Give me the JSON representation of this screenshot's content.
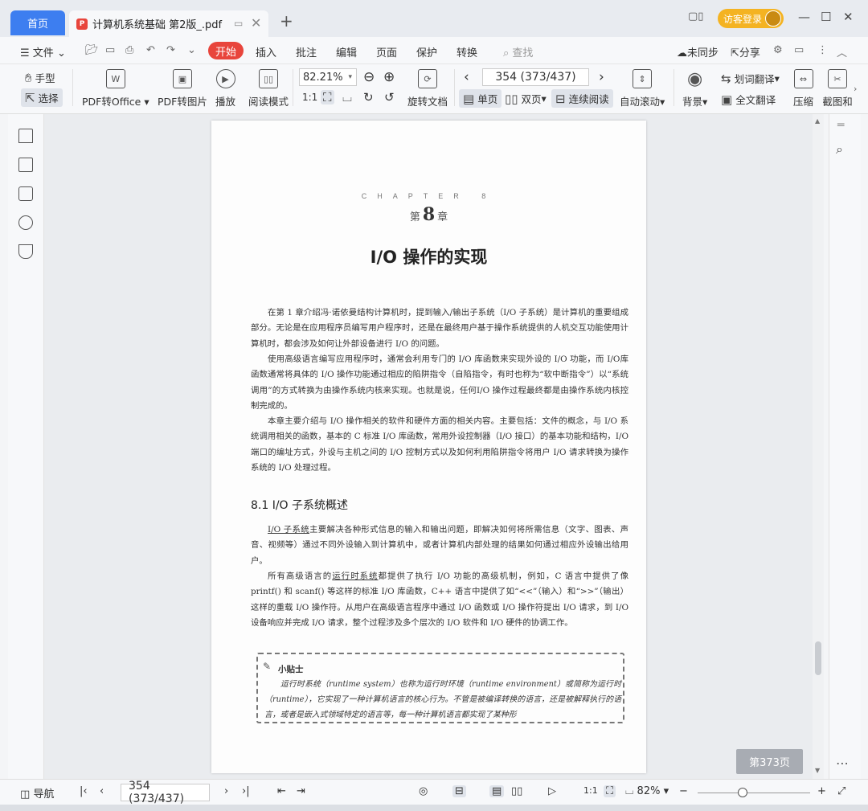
{
  "tabs": {
    "home": "首页",
    "doc_title": "计算机系统基础 第2版_.pdf"
  },
  "titlebar": {
    "guest_login": "访客登录"
  },
  "menu": {
    "file": "文件",
    "start": "开始",
    "items": [
      "插入",
      "批注",
      "编辑",
      "页面",
      "保护",
      "转换"
    ],
    "search_placeholder": "查找",
    "unsynced": "未同步",
    "share": "分享"
  },
  "ribbon": {
    "hand_tool": "手型",
    "select_tool": "选择",
    "pdf_to_office": "PDF转Office",
    "pdf_to_image": "PDF转图片",
    "play": "播放",
    "read_mode": "阅读模式",
    "zoom": "82.21%",
    "rotate_doc": "旋转文档",
    "page_input": "354 (373/437)",
    "single_page": "单页",
    "double_page": "双页",
    "continuous_read": "连续阅读",
    "auto_scroll": "自动滚动",
    "background": "背景",
    "word_translate": "划词翻译",
    "full_translate": "全文翻译",
    "compress": "压缩",
    "screenshot": "截图和"
  },
  "document": {
    "chapter_en": "CHAPTER 8",
    "chapter_prefix": "第",
    "chapter_number": "8",
    "chapter_suffix": "章",
    "chapter_title": "I/O 操作的实现",
    "intro_paragraphs": [
      "在第 1 章介绍冯·诺依曼结构计算机时，提到输入/输出子系统（I/O 子系统）是计算机的重要组成部分。无论是在应用程序员编写用户程序时，还是在最终用户基于操作系统提供的人机交互功能使用计算机时，都会涉及如何让外部设备进行 I/O 的问题。",
      "使用高级语言编写应用程序时，通常会利用专门的 I/O 库函数来实现外设的 I/O 功能，而 I/O库函数通常将具体的 I/O 操作功能通过相应的陷阱指令（自陷指令，有时也称为“软中断指令”）以“系统调用”的方式转换为由操作系统内核来实现。也就是说，任何I/O 操作过程最终都是由操作系统内核控制完成的。",
      "本章主要介绍与 I/O 操作相关的软件和硬件方面的相关内容。主要包括：文件的概念，与 I/O 系统调用相关的函数，基本的 C 标准 I/O 库函数，常用外设控制器（I/O 接口）的基本功能和结构，I/O 端口的编址方式，外设与主机之间的 I/O 控制方式以及如何利用陷阱指令将用户 I/O 请求转换为操作系统的 I/O 处理过程。"
    ],
    "section_title": "8.1   I/O 子系统概述",
    "section_p1_term": "I/O 子系统",
    "section_p1_rest": "主要解决各种形式信息的输入和输出问题，即解决如何将所需信息（文字、图表、声音、视频等）通过不同外设输入到计算机中，或者计算机内部处理的结果如何通过相应外设输出给用户。",
    "section_p2_pre": "所有高级语言的",
    "section_p2_term": "运行时系统",
    "section_p2_rest": "都提供了执行 I/O 功能的高级机制，例如，C 语言中提供了像 printf() 和 scanf() 等这样的标准 I/O 库函数，C++ 语言中提供了如“<<”（输入）和“>>”（输出）这样的重载 I/O 操作符。从用户在高级语言程序中通过 I/O 函数或 I/O 操作符提出 I/O 请求，到 I/O 设备响应并完成 I/O 请求，整个过程涉及多个层次的 I/O 软件和 I/O 硬件的协调工作。",
    "tip_title": "小贴士",
    "tip_body": "运行时系统（runtime system）也称为运行时环境（runtime environment）或简称为运行时（runtime），它实现了一种计算机语言的核心行为。不管是被编译转换的语言，还是被解释执行的语言，或者是嵌入式领域特定的语言等，每一种计算机语言都实现了某种形"
  },
  "page_badge": "第373页",
  "statusbar": {
    "nav": "导航",
    "page_input": "354 (373/437)",
    "zoom": "82%"
  }
}
